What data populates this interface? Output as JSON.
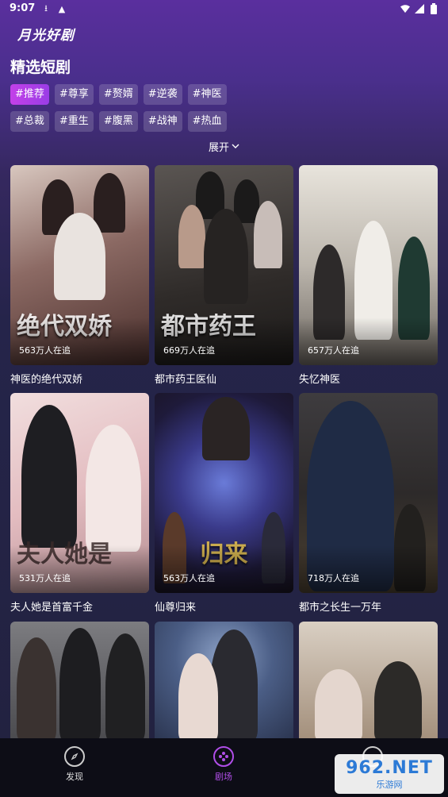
{
  "status": {
    "time": "9:07"
  },
  "app": {
    "title": "月光好剧"
  },
  "section": {
    "title": "精选短剧"
  },
  "tags": [
    "#推荐",
    "#尊享",
    "#赘婿",
    "#逆袭",
    "#神医",
    "#总裁",
    "#重生",
    "#腹黑",
    "#战神",
    "#热血"
  ],
  "expand_label": "展开",
  "dramas": [
    {
      "title": "神医的绝代双娇",
      "count": "563万人在追",
      "deco": "绝代双娇",
      "bg": "#7a5b58"
    },
    {
      "title": "都市药王医仙",
      "count": "669万人在追",
      "deco": "都市药王",
      "bg": "#3d3836"
    },
    {
      "title": "失忆神医",
      "count": "657万人在追",
      "deco": "",
      "bg": "#c7c2b9"
    },
    {
      "title": "夫人她是首富千金",
      "count": "531万人在追",
      "deco": "夫人她是",
      "bg": "#e4c6c6"
    },
    {
      "title": "仙尊归来",
      "count": "563万人在追",
      "deco": "归来",
      "bg": "#2a2a52"
    },
    {
      "title": "都市之长生一万年",
      "count": "718万人在追",
      "deco": "",
      "bg": "#3b3a3e"
    },
    {
      "title": "",
      "count": "",
      "deco": "",
      "bg": "#5a5b60"
    },
    {
      "title": "",
      "count": "",
      "deco": "",
      "bg": "#4b5670"
    },
    {
      "title": "",
      "count": "",
      "deco": "",
      "bg": "#b9a998"
    }
  ],
  "nav": [
    {
      "label": "发现",
      "icon": "compass-icon"
    },
    {
      "label": "剧场",
      "icon": "film-reel-icon"
    }
  ],
  "watermark": {
    "main": "962.NET",
    "sub": "乐游网"
  }
}
